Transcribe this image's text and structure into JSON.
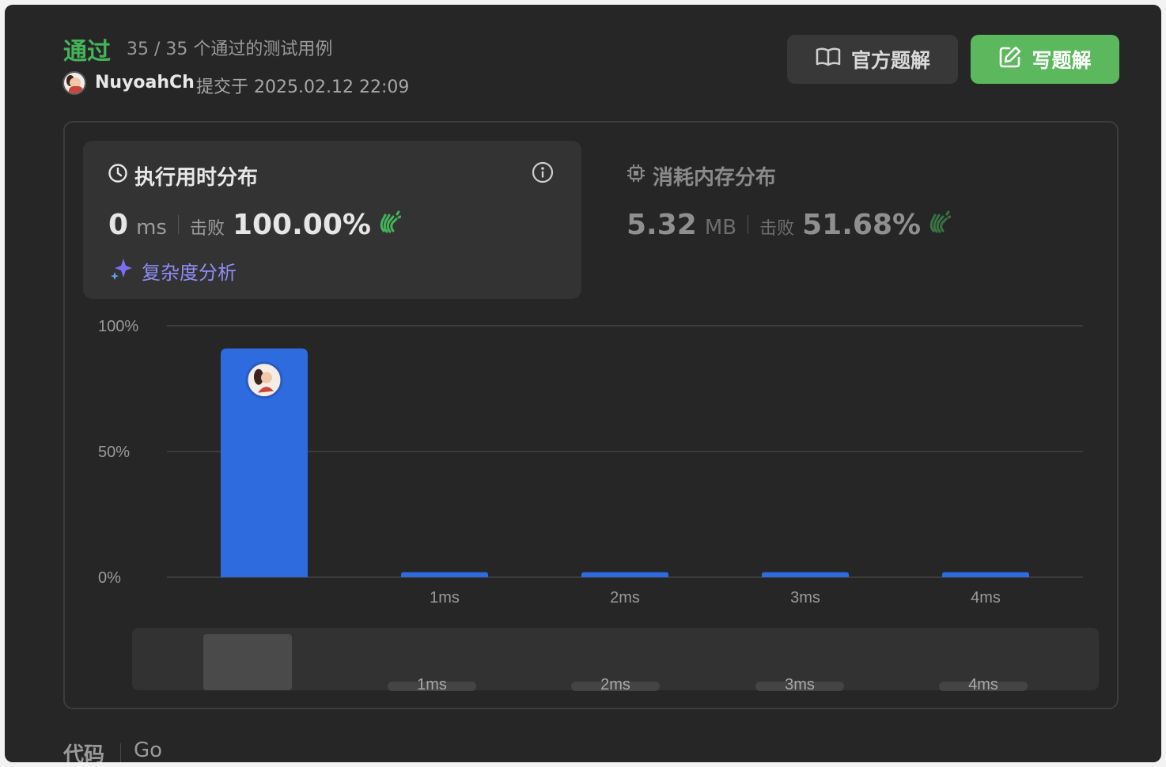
{
  "header": {
    "status": "通过",
    "passed_text": "35 / 35 个通过的测试用例",
    "username": "NuyoahCh",
    "submitted_text": "提交于 2025.02.12 22:09",
    "official_solution_label": "官方题解",
    "write_solution_label": "写题解"
  },
  "runtime": {
    "title": "执行用时分布",
    "value": "0",
    "unit": "ms",
    "beats_label": "击败",
    "beats": "100.00%",
    "complexity_label": "复杂度分析"
  },
  "memory": {
    "title": "消耗内存分布",
    "value": "5.32",
    "unit": "MB",
    "beats_label": "击败",
    "beats": "51.68%"
  },
  "chart_data": {
    "type": "bar",
    "y_ticks": [
      "100%",
      "50%",
      "0%"
    ],
    "ylim": [
      0,
      100
    ],
    "categories": [
      "0ms",
      "1ms",
      "2ms",
      "3ms",
      "4ms"
    ],
    "x_tick_labels": [
      "",
      "1ms",
      "2ms",
      "3ms",
      "4ms"
    ],
    "values": [
      91,
      2,
      2,
      2,
      2
    ],
    "highlight_index": 0,
    "bar_color": "#2e6bde",
    "grid": true
  },
  "overview": {
    "labels": [
      "1ms",
      "2ms",
      "3ms",
      "4ms"
    ]
  },
  "code": {
    "label": "代码",
    "language": "Go"
  },
  "colors": {
    "accent_green": "#44b35a",
    "button_green": "#5cb85c",
    "complexity_purple": "#8f8cf5",
    "bar_blue": "#2e6bde"
  }
}
